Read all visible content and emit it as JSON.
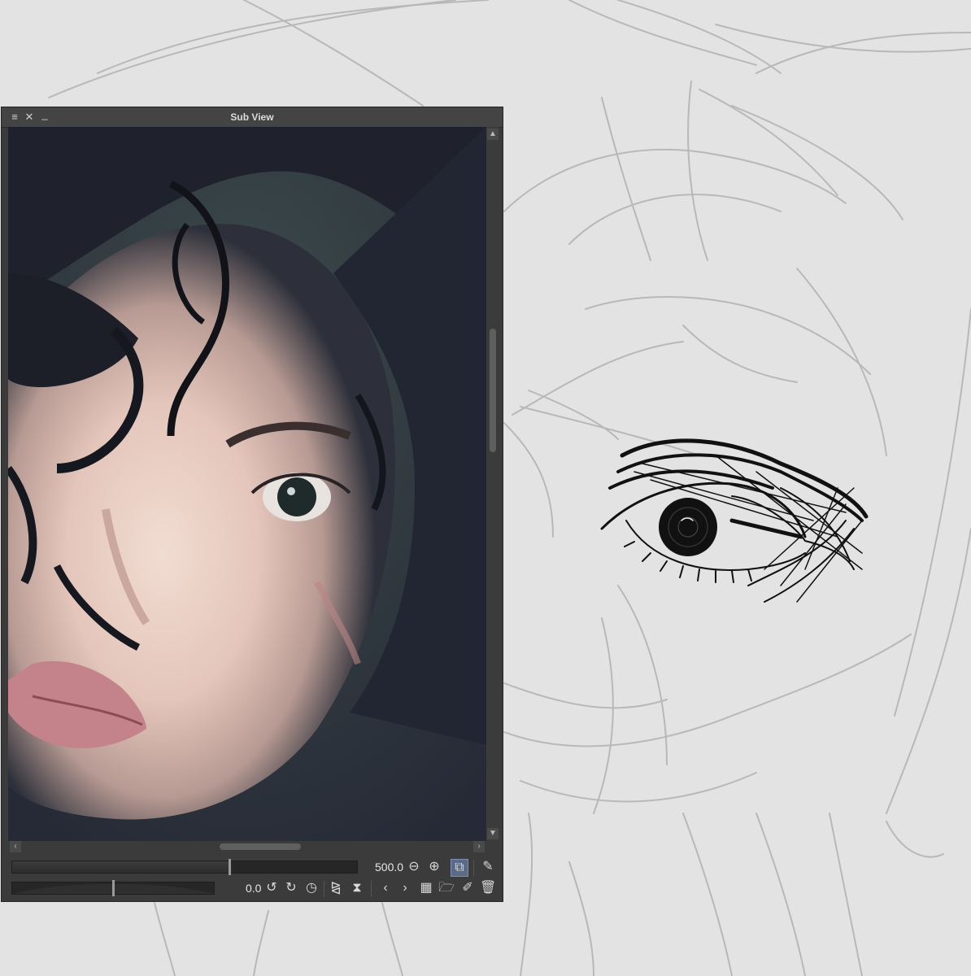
{
  "subview": {
    "title": "Sub View",
    "zoom_value": "500.0",
    "rotation_value": "0.0",
    "zoom_level": 0.63,
    "rotation_level": 0.5
  },
  "icons": {
    "menu": "menu-icon",
    "close": "close-icon",
    "minimize": "minimize-icon",
    "zoom_out": "zoom-out-icon",
    "zoom_in": "zoom-in-icon",
    "fit": "fit-to-window-icon",
    "eyedropper": "eyedropper-icon",
    "rotate_left": "rotate-left-icon",
    "rotate_right": "rotate-right-icon",
    "reset_rotation": "reset-rotation-icon",
    "flip_h": "flip-horizontal-icon",
    "flip_v": "flip-vertical-icon",
    "prev": "previous-image-icon",
    "next": "next-image-icon",
    "grid": "grid-view-icon",
    "import": "import-image-icon",
    "edit": "edit-image-icon",
    "delete": "delete-image-icon"
  },
  "colors": {
    "canvas": "#e3e3e3",
    "panel": "#3b3b3b",
    "sketch_line": "#b4b4b4",
    "ink": "#111111"
  }
}
